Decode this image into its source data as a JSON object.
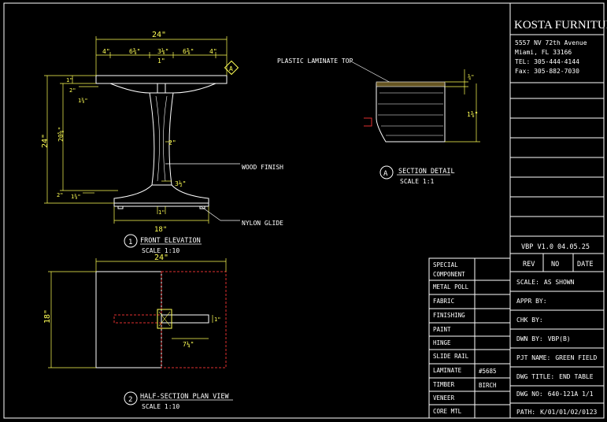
{
  "title_block": {
    "company": "KOSTA FURNITURE",
    "address": [
      "5557 NV 72th Avenue",
      "Miami, FL  33166",
      "TEL: 305-444-4144",
      "Fax: 305-882-7030"
    ],
    "version": "VBP   V1.0  04.05.25",
    "rev_header": [
      "REV",
      "NO",
      "DATE"
    ],
    "fields": [
      {
        "label": "SCALE:",
        "value": "AS SHOWN"
      },
      {
        "label": "APPR BY:",
        "value": ""
      },
      {
        "label": "CHK BY:",
        "value": ""
      },
      {
        "label": "DWN BY:",
        "value": "VBP(B)"
      },
      {
        "label": "PJT NAME:",
        "value": "GREEN FIELD"
      },
      {
        "label": "DWG TITLE:",
        "value": "END TABLE"
      },
      {
        "label": "DWG NO:",
        "value": "640-121A    1/1"
      },
      {
        "label": "PATH:",
        "value": "K/01/01/02/0123"
      }
    ]
  },
  "spec_table": [
    {
      "label": "SPECIAL\nCOMPONENT",
      "value": ""
    },
    {
      "label": "METAL POLL",
      "value": ""
    },
    {
      "label": "FABRIC",
      "value": ""
    },
    {
      "label": "FINISHING",
      "value": ""
    },
    {
      "label": "PAINT",
      "value": ""
    },
    {
      "label": "HINGE",
      "value": ""
    },
    {
      "label": "SLIDE RAIL",
      "value": ""
    },
    {
      "label": "LAMINATE",
      "value": "#5685"
    },
    {
      "label": "TIMBER",
      "value": "BIRCH"
    },
    {
      "label": "VENEER",
      "value": ""
    },
    {
      "label": "CORE MTL",
      "value": ""
    }
  ],
  "views": {
    "front": {
      "num": "1",
      "title": "FRONT ELEVATION",
      "scale": "SCALE 1:10"
    },
    "section": {
      "num": "A",
      "title": "SECTION DETAIL",
      "scale": "SCALE 1:1"
    },
    "plan": {
      "num": "2",
      "title": "HALF-SECTION PLAN VIEW",
      "scale": "SCALE 1:10"
    }
  },
  "callouts": {
    "laminate": "PLASTIC LAMINATE TOP",
    "wood": "WOOD FINISH",
    "glide": "NYLON GLIDE",
    "section_marker": "A"
  },
  "dimensions": {
    "top_width": "24\"",
    "top_left": "4\"",
    "top_mid_l": "6⅜\"",
    "top_center": "3⅛\"",
    "top_mid_r": "6⅜\"",
    "top_right": "4\"",
    "top_small": "1\"",
    "height": "24\"",
    "leg_h": "20⅝\"",
    "top_thk": "1\"",
    "apron": "2\"",
    "apron2": "1⅜\"",
    "base": "2\"",
    "base2": "1⅜\"",
    "stem": "2\"",
    "stem2": "3½\"",
    "foot": "18\"",
    "foot_small": "1\"",
    "sec_v1": "¾\"",
    "sec_v2": "1⅜\"",
    "plan_w": "24\"",
    "plan_h": "18\"",
    "plan_a": "7¼\"",
    "plan_b": "1\""
  }
}
